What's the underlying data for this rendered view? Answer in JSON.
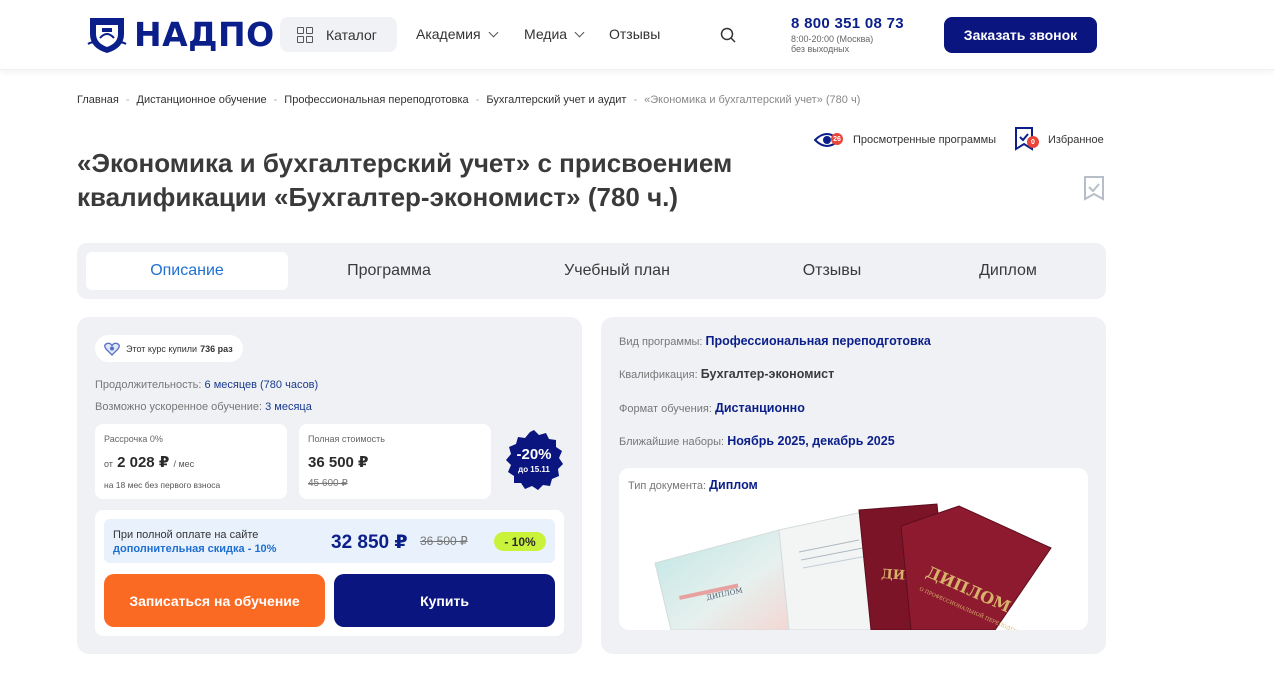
{
  "header": {
    "logo_text": "НАДПО",
    "catalog_label": "Каталог",
    "nav": [
      {
        "label": "Академия",
        "has_dropdown": true
      },
      {
        "label": "Медиа",
        "has_dropdown": true
      },
      {
        "label": "Отзывы",
        "has_dropdown": false
      }
    ],
    "phone": "8 800 351 08 73",
    "phone_hours": "8:00-20:00 (Москва)",
    "phone_days": "без выходных",
    "call_button": "Заказать звонок",
    "colors": {
      "brand": "#0b1f8a",
      "button": "#0b1580"
    }
  },
  "breadcrumb": {
    "items": [
      "Главная",
      "Дистанционное обучение",
      "Профессиональная переподготовка",
      "Бухгалтерский учет и аудит"
    ],
    "current": "«Экономика и бухгалтерский учет» (780 ч)"
  },
  "viewed": {
    "label": "Просмотренные программы",
    "count": "26"
  },
  "favorites": {
    "label": "Избранное",
    "count": "0"
  },
  "title": "«Экономика и бухгалтерский учет» с присвоением квалификации «Бухгалтер-экономист» (780 ч.)",
  "tabs": [
    "Описание",
    "Программа",
    "Учебный план",
    "Отзывы",
    "Диплом"
  ],
  "active_tab": "Описание",
  "course": {
    "bought_text": "Этот курс купили",
    "bought_count": "736 раз",
    "duration_label": "Продолжительность:",
    "duration_value": "6 месяцев (780 часов)",
    "accelerated_label": "Возможно ускоренное обучение:",
    "accelerated_value": "3 месяца",
    "installment": {
      "label": "Рассрочка 0%",
      "prefix": "от",
      "amount": "2 028 ₽",
      "period": "/ мес",
      "note": "на 18 мес без первого взноса"
    },
    "full_price": {
      "label": "Полная стоимость",
      "amount": "36 500 ₽",
      "old": "45 600 ₽"
    },
    "discount_badge": {
      "pct": "-20%",
      "until": "до 15.11",
      "color": "#0b1580"
    },
    "full_pay": {
      "line1": "При полной оплате на сайте",
      "line2": "дополнительная скидка - 10%",
      "price": "32 850 ₽",
      "old": "36 500 ₽",
      "pct": "- 10%"
    },
    "enroll_button": "Записаться на обучение",
    "buy_button": "Купить",
    "colors": {
      "enroll": "#fb6a23",
      "pct_badge": "#c9f23a"
    }
  },
  "details": {
    "program_type_label": "Вид программы:",
    "program_type": "Профессиональная переподготовка",
    "qualification_label": "Квалификация:",
    "qualification": "Бухгалтер-экономист",
    "format_label": "Формат обучения:",
    "format": "Дистанционно",
    "intake_label": "Ближайшие наборы:",
    "intake": "Ноябрь 2025, декабрь 2025",
    "doc_type_label": "Тип документа:",
    "doc_type": "Диплом",
    "diploma_cover_text": "ДИПЛОМ",
    "diploma_cover_sub": "О ПРОФЕССИОНАЛЬНОЙ ПЕРЕПОДГОТОВКЕ",
    "diploma_inner_title": "ДИПЛОМ"
  }
}
